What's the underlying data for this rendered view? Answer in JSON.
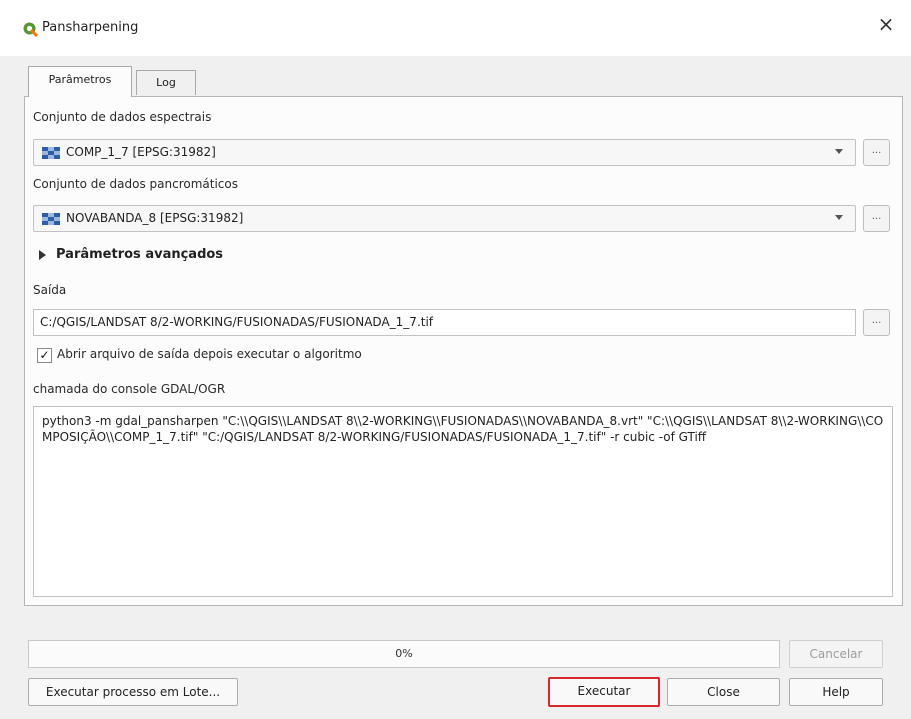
{
  "window": {
    "title": "Pansharpening",
    "close_label": "×",
    "accent_color": "#589632"
  },
  "tabs": [
    {
      "label": "Parâmetros",
      "active": true
    },
    {
      "label": "Log",
      "active": false
    }
  ],
  "form": {
    "spectral_label": "Conjunto de dados espectrais",
    "spectral_value": "COMP_1_7 [EPSG:31982]",
    "panchromatic_label": "Conjunto de dados pancromáticos",
    "panchromatic_value": "NOVABANDA_8 [EPSG:31982]",
    "browse_label": "...",
    "advanced_label": "Parâmetros avançados",
    "output_label": "Saída",
    "output_value": "C:/QGIS/LANDSAT 8/2-WORKING/FUSIONADAS/FUSIONADA_1_7.tif",
    "open_output_checked": true,
    "open_output_label": "Abrir arquivo de saída depois executar o algoritmo",
    "console_label": "chamada do console GDAL/OGR",
    "console_text": "python3 -m gdal_pansharpen \"C:\\\\QGIS\\\\LANDSAT 8\\\\2-WORKING\\\\FUSIONADAS\\\\NOVABANDA_8.vrt\" \"C:\\\\QGIS\\\\LANDSAT 8\\\\2-WORKING\\\\COMPOSIÇÃO\\\\COMP_1_7.tif\" \"C:/QGIS/LANDSAT 8/2-WORKING/FUSIONADAS/FUSIONADA_1_7.tif\" -r cubic -of GTiff"
  },
  "footer": {
    "progress_text": "0%",
    "progress_value": 0,
    "cancel_label": "Cancelar",
    "batch_label": "Executar processo em Lote...",
    "run_label": "Executar",
    "close_label": "Close",
    "help_label": "Help"
  }
}
